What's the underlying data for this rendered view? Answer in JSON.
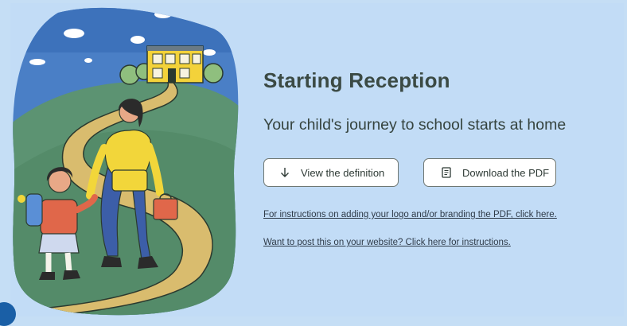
{
  "hero": {
    "title": "Starting Reception",
    "subtitle": "Your child's journey to school starts at home"
  },
  "actions": {
    "view_definition_label": "View the definition",
    "view_definition_icon": "arrow-down-icon",
    "download_pdf_label": "Download the PDF",
    "download_pdf_icon": "document-icon"
  },
  "links": {
    "branding_instructions": "For instructions on adding your logo and/or branding the PDF, click here.",
    "website_instructions": "Want to post this on your website? Click here for instructions."
  },
  "colors": {
    "background": "#c2dcf6",
    "title_text": "#3b4a44",
    "button_border": "#6f7772"
  }
}
